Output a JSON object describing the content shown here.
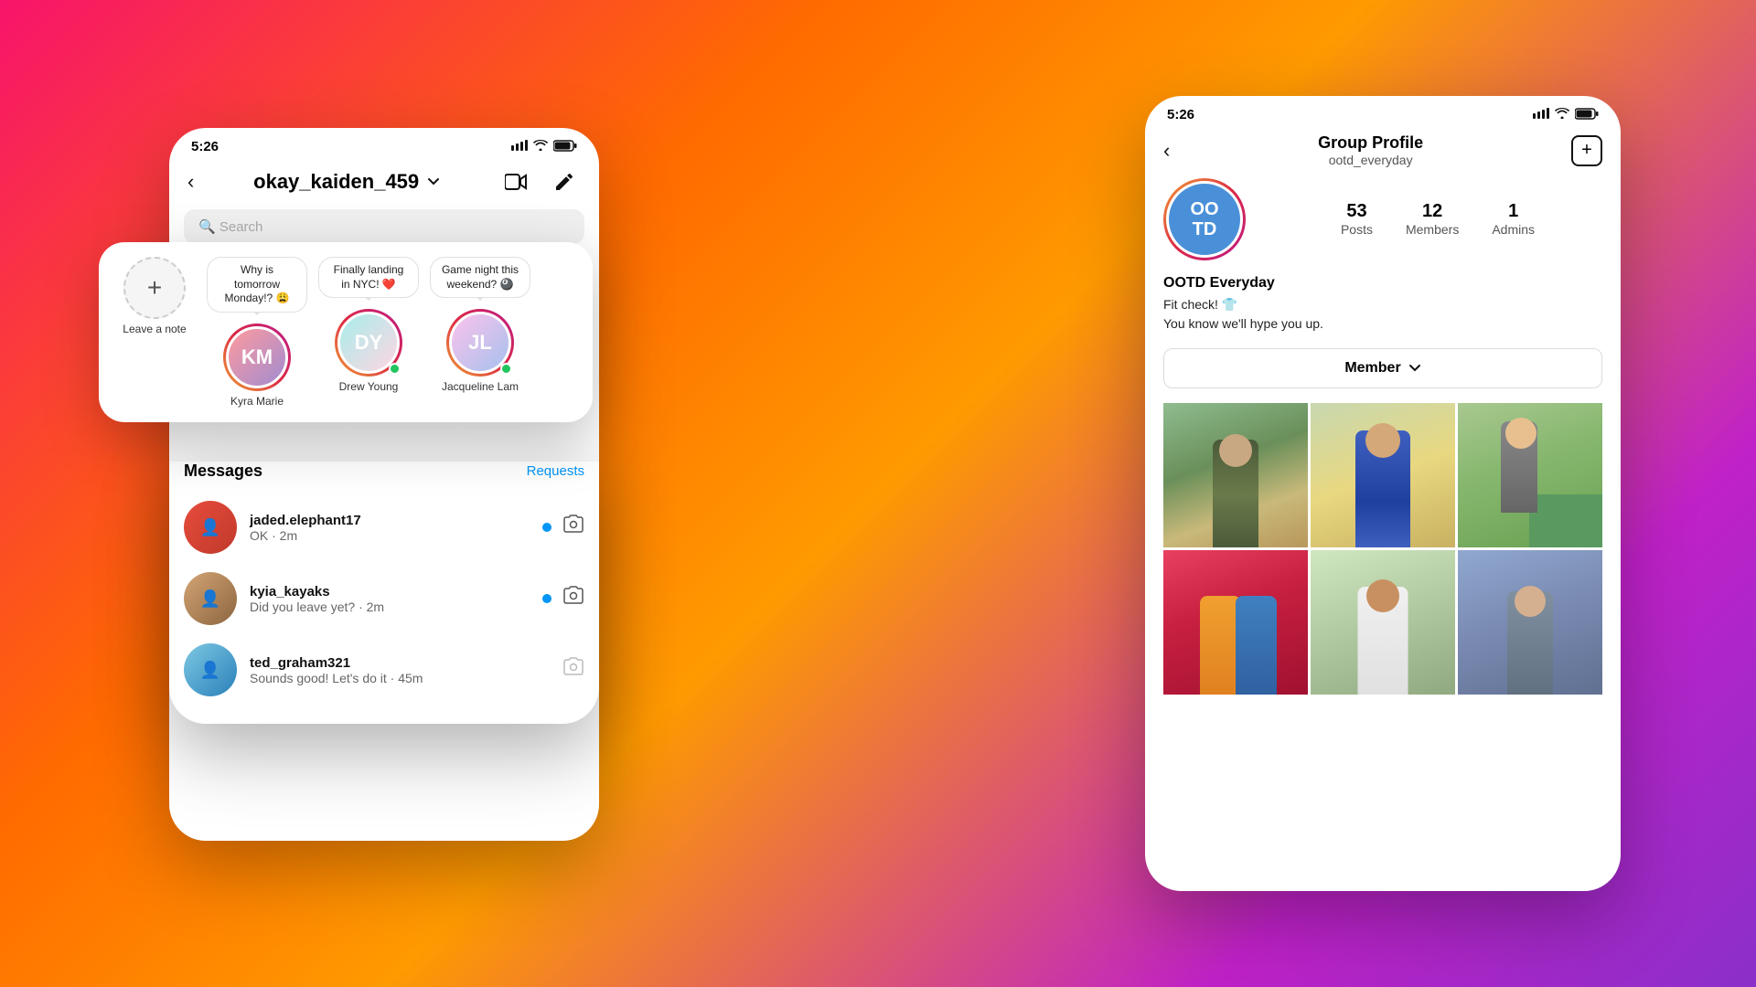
{
  "background": {
    "gradient": "linear-gradient(135deg, #f7146b 0%, #ff6a00 30%, #ff9a00 50%, #c021c8 80%, #8b2fc9 100%)"
  },
  "left_phone": {
    "status_bar": {
      "time": "5:26",
      "signal": "▌▌▌",
      "wifi": "wifi",
      "battery": "🔋"
    },
    "header": {
      "back": "‹",
      "username": "okay_kaiden_459",
      "chevron": "∨",
      "video_icon": "video",
      "compose_icon": "compose"
    },
    "search_placeholder": "Search",
    "stories": [
      {
        "id": "self",
        "name": "Leave a note",
        "add": true
      },
      {
        "id": "kyra",
        "name": "Kyra Marie",
        "note": "Why is tomorrow Monday!? 😩",
        "online": false
      },
      {
        "id": "drew",
        "name": "Drew Young",
        "note": "Finally landing in NYC! ❤️",
        "online": true
      },
      {
        "id": "jac",
        "name": "Jacqueline Lam",
        "note": "Game night this weekend? 🎱",
        "online": true
      }
    ],
    "messages_label": "Messages",
    "requests_label": "Requests",
    "messages": [
      {
        "username": "jaded.elephant17",
        "preview": "OK · 2m",
        "unread": true,
        "avatar_color": "red"
      },
      {
        "username": "kyia_kayaks",
        "preview": "Did you leave yet? · 2m",
        "unread": true,
        "avatar_color": "tan"
      },
      {
        "username": "ted_graham321",
        "preview": "Sounds good! Let's do it · 45m",
        "unread": false,
        "avatar_color": "blue"
      }
    ]
  },
  "right_phone": {
    "status_bar": {
      "time": "5:26"
    },
    "header": {
      "back": "‹",
      "title": "Group Profile",
      "subtitle": "ootd_everyday",
      "add_icon": "+"
    },
    "group": {
      "avatar_text": "OO\nTD",
      "name": "OOTD Everyday",
      "bio_line1": "Fit check! 👕",
      "bio_line2": "You know we'll hype you up.",
      "posts_count": "53",
      "posts_label": "Posts",
      "members_count": "12",
      "members_label": "Members",
      "admins_count": "1",
      "admins_label": "Admins",
      "member_btn_label": "Member",
      "member_btn_chevron": "∨"
    },
    "photos": [
      {
        "id": 1,
        "desc": "man in olive outfit"
      },
      {
        "id": 2,
        "desc": "woman in blue coat"
      },
      {
        "id": 3,
        "desc": "person by green car"
      },
      {
        "id": 4,
        "desc": "couple in colorful outfit"
      },
      {
        "id": 5,
        "desc": "man in white jacket"
      },
      {
        "id": 6,
        "desc": "person in casual wear"
      }
    ]
  }
}
